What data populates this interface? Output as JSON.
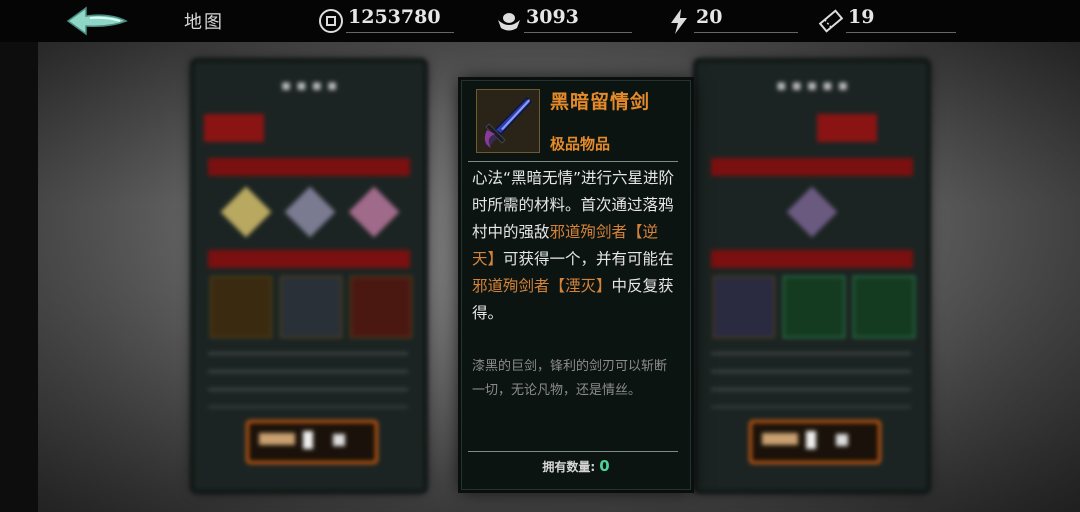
{
  "header": {
    "title": "地图",
    "coins": "1253780",
    "ingots": "3093",
    "energy": "20",
    "tickets": "19"
  },
  "item": {
    "name": "黑暗留情剑",
    "grade": "极品物品",
    "effect_segments": [
      {
        "text": "心法“黑暗无情”进行六星进阶时所需的材料。首次通过落鸦村中的强敌",
        "hl": false
      },
      {
        "text": "邪道殉剑者【逆天】",
        "hl": true
      },
      {
        "text": "可获得一个，并有可能在",
        "hl": false
      },
      {
        "text": "邪道殉剑者【湮灭】",
        "hl": true
      },
      {
        "text": "中反复获得。",
        "hl": false
      }
    ],
    "flavor": "漆黑的巨剑，锋利的剑刃可以斩断一切，无论凡物，还是情丝。",
    "owned_label": "拥有数量:",
    "owned_count": "0"
  },
  "colors": {
    "accent": "#e48a2a",
    "highlight": "#d6833a",
    "owned_count": "#4bd19a",
    "tab_active": "#8a1414"
  }
}
